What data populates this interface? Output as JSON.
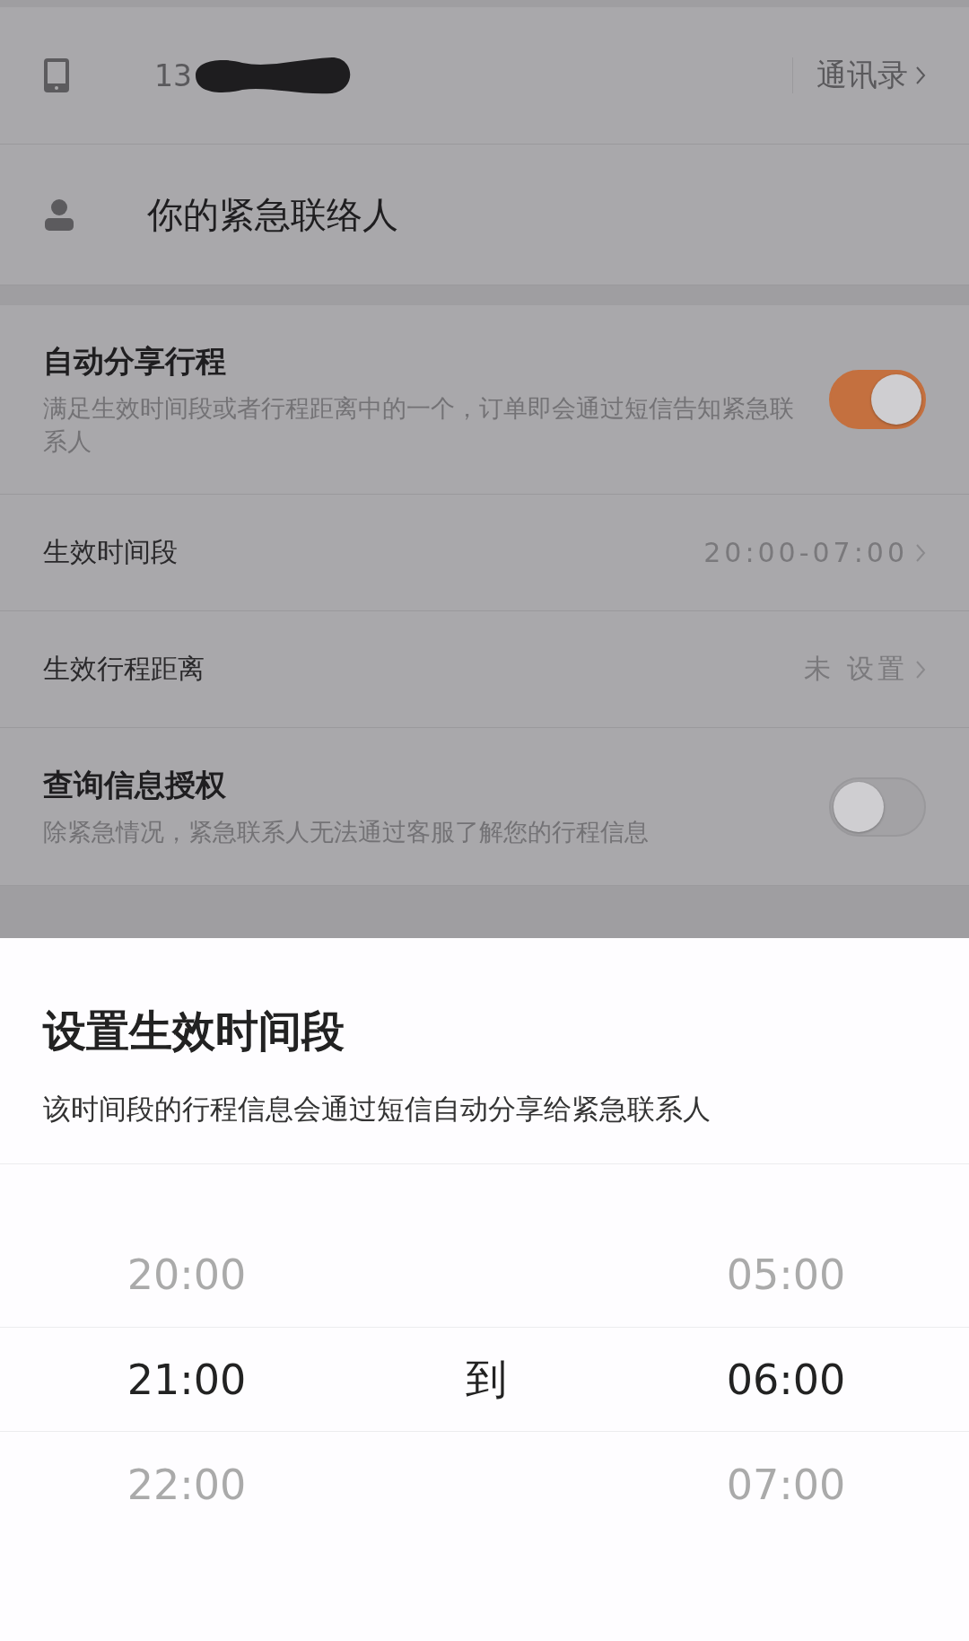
{
  "phone": {
    "number": "13",
    "contacts_link": "通讯录"
  },
  "emergency_contact": {
    "label": "你的紧急联络人"
  },
  "settings": [
    {
      "kind": "toggle",
      "title": "自动分享行程",
      "description": "满足生效时间段或者行程距离中的一个，订单即会通过短信告知紧急联系人",
      "on": true
    },
    {
      "kind": "link",
      "label": "生效时间段",
      "value": "20:00-07:00"
    },
    {
      "kind": "link",
      "label": "生效行程距离",
      "value": "未 设置"
    },
    {
      "kind": "toggle",
      "title": "查询信息授权",
      "description": "除紧急情况，紧急联系人无法通过客服了解您的行程信息",
      "on": false
    }
  ],
  "sheet": {
    "title": "设置生效时间段",
    "subtitle": "该时间段的行程信息会通过短信自动分享给紧急联系人",
    "picker": {
      "separator": "到",
      "start": [
        {
          "label": "20:00",
          "selected": false
        },
        {
          "label": "21:00",
          "selected": true
        },
        {
          "label": "22:00",
          "selected": false
        }
      ],
      "end": [
        {
          "label": "05:00",
          "selected": false
        },
        {
          "label": "06:00",
          "selected": true
        },
        {
          "label": "07:00",
          "selected": false
        }
      ]
    }
  }
}
